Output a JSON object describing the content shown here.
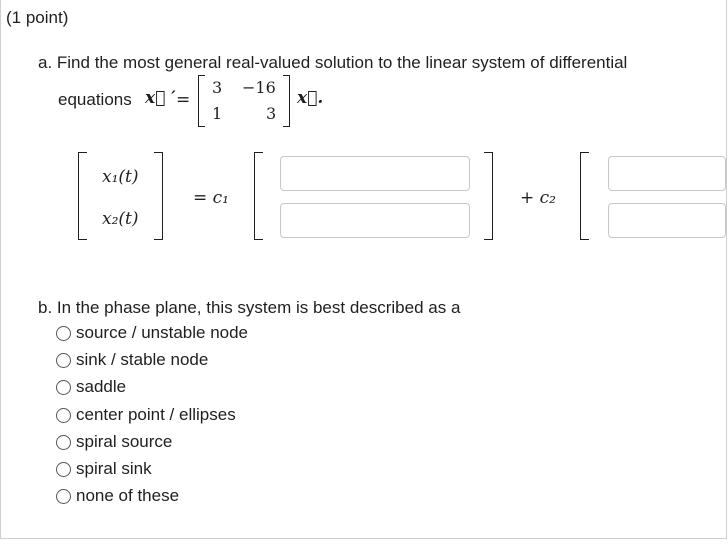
{
  "header": {
    "points": "(1 point)"
  },
  "part_a": {
    "prompt": "a. Find the most general real-valued solution to the linear system of differential",
    "equations_label": "equations",
    "x_prime": "x⃗ ′",
    "equals": "=",
    "matrix": [
      [
        "3",
        "−16"
      ],
      [
        "1",
        "3"
      ]
    ],
    "x_vec": "x⃗.",
    "x1": "x₁(t)",
    "x2": "x₂(t)",
    "c1_term": "= c₁",
    "c2_term": "+ c₂",
    "inputs": [
      "",
      "",
      "",
      ""
    ]
  },
  "part_b": {
    "prompt": "b. In the phase plane, this system is best described as a",
    "options": [
      "source / unstable node",
      "sink / stable node",
      "saddle",
      "center point / ellipses",
      "spiral source",
      "spiral sink",
      "none of these"
    ]
  }
}
